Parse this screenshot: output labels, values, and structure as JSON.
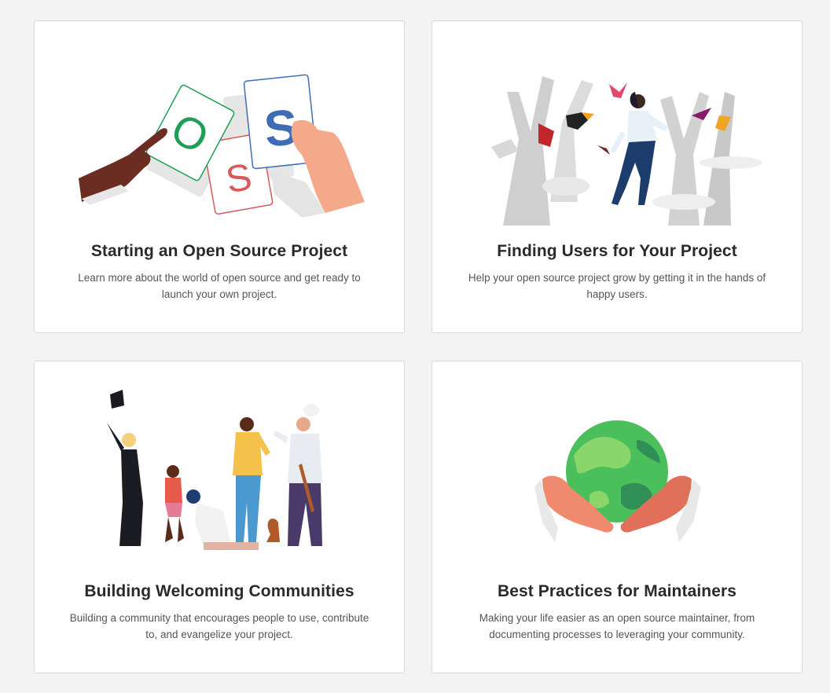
{
  "cards": [
    {
      "title": "Starting an Open Source Project",
      "description": "Learn more about the world of open source and get ready to launch your own project.",
      "illustration": "cards-hands-illustration",
      "cards_letters": [
        "O",
        "S",
        "S"
      ]
    },
    {
      "title": "Finding Users for Your Project",
      "description": "Help your open source project grow by getting it in the hands of happy users.",
      "illustration": "forest-birds-illustration"
    },
    {
      "title": "Building Welcoming Communities",
      "description": "Building a community that encourages people to use, contribute to, and evangelize your project.",
      "illustration": "community-people-illustration"
    },
    {
      "title": "Best Practices for Maintainers",
      "description": "Making your life easier as an open source maintainer, from documenting processes to leveraging your community.",
      "illustration": "hands-globe-illustration"
    }
  ],
  "colors": {
    "background": "#f3f3f3",
    "card": "#ffffff",
    "card_border": "#d9d9d9",
    "title": "#2a2a2a",
    "text": "#555555"
  }
}
